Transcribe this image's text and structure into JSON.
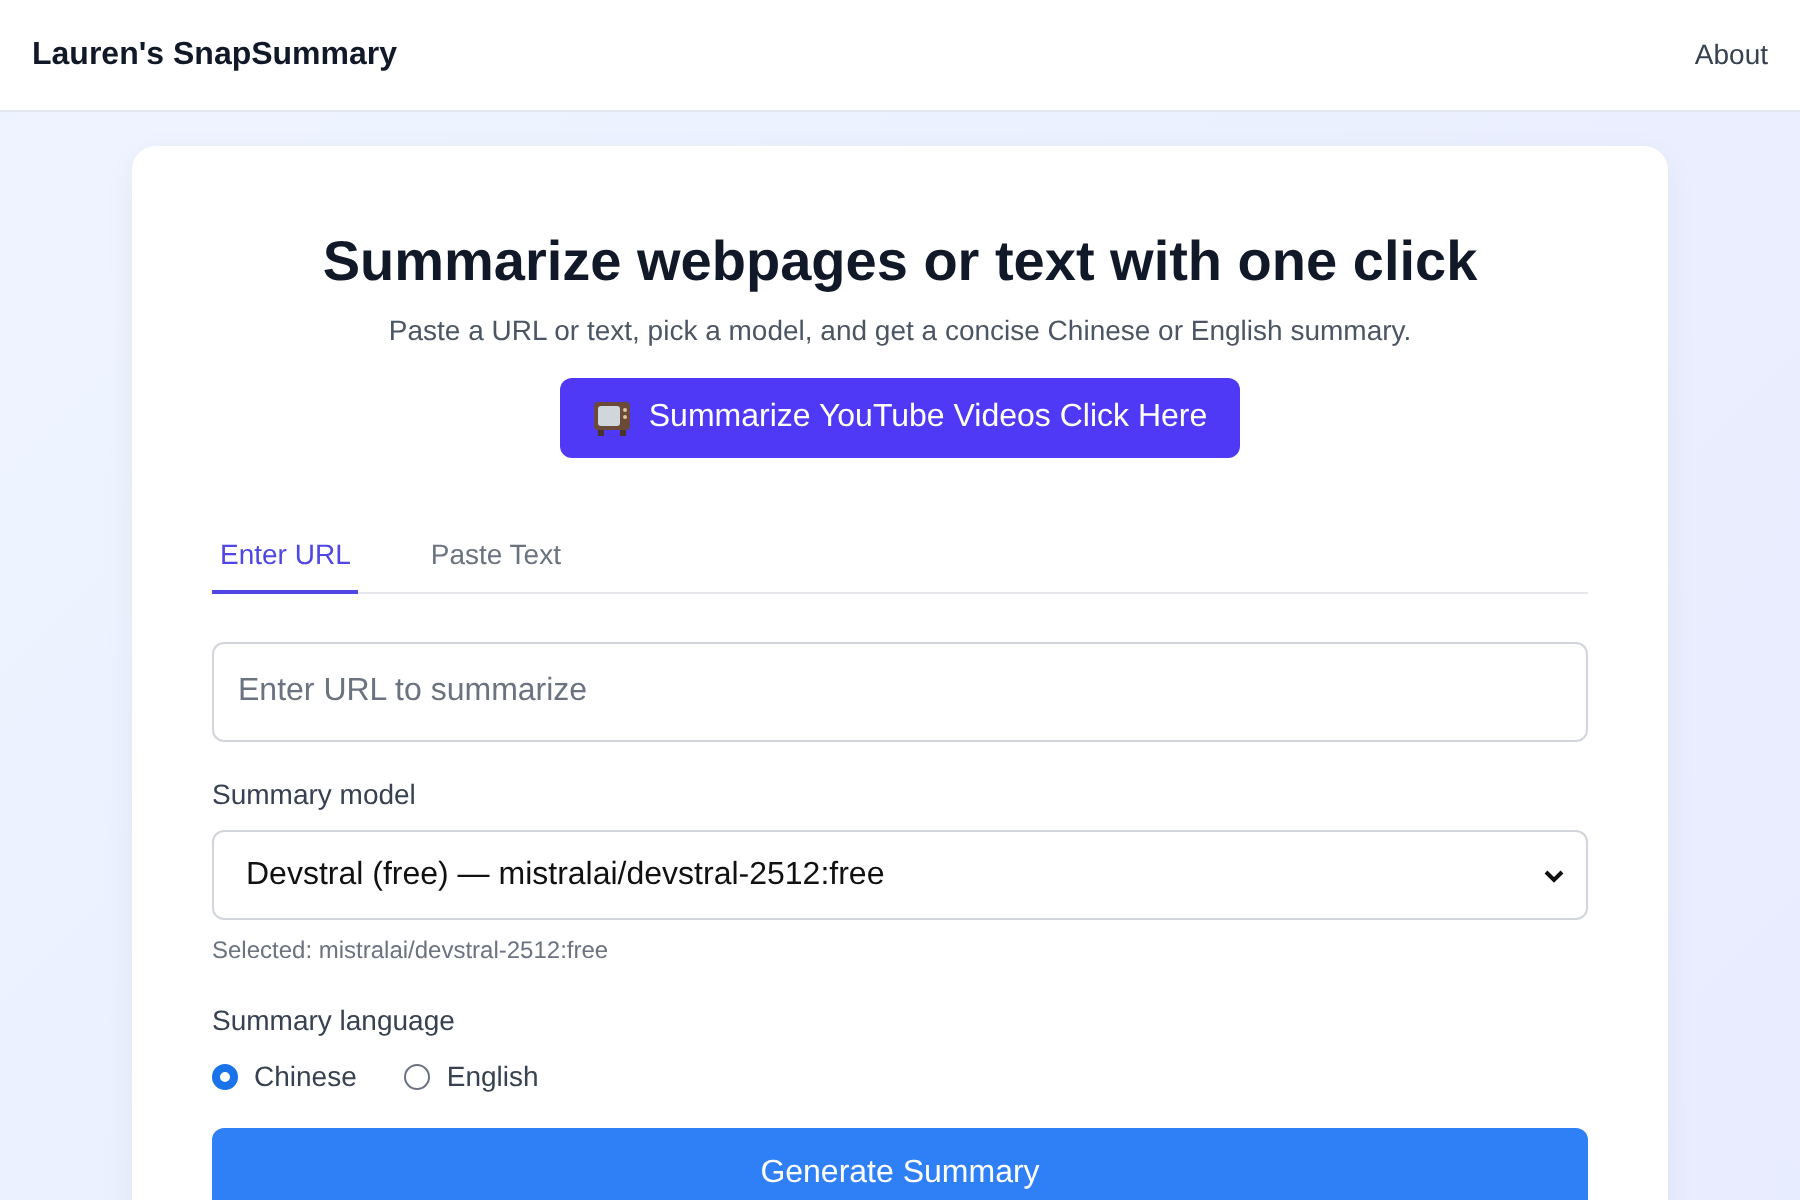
{
  "header": {
    "brand": "Lauren's SnapSummary",
    "nav": [
      {
        "label": "About"
      }
    ]
  },
  "hero": {
    "title": "Summarize webpages or text with one click",
    "subtitle": "Paste a URL or text, pick a model, and get a concise Chinese or English summary.",
    "youtube_button": "Summarize YouTube Videos Click Here"
  },
  "tabs": [
    {
      "label": "Enter URL",
      "selected": true
    },
    {
      "label": "Paste Text",
      "selected": false
    }
  ],
  "url_field": {
    "placeholder": "Enter URL to summarize"
  },
  "model": {
    "label": "Summary model",
    "value": "Devstral (free) — mistralai/devstral-2512:free",
    "hint": "Selected: mistralai/devstral-2512:free"
  },
  "language": {
    "label": "Summary language",
    "options": [
      {
        "label": "Chinese",
        "selected": true
      },
      {
        "label": "English",
        "selected": false
      }
    ]
  },
  "generate_button": "Generate Summary"
}
